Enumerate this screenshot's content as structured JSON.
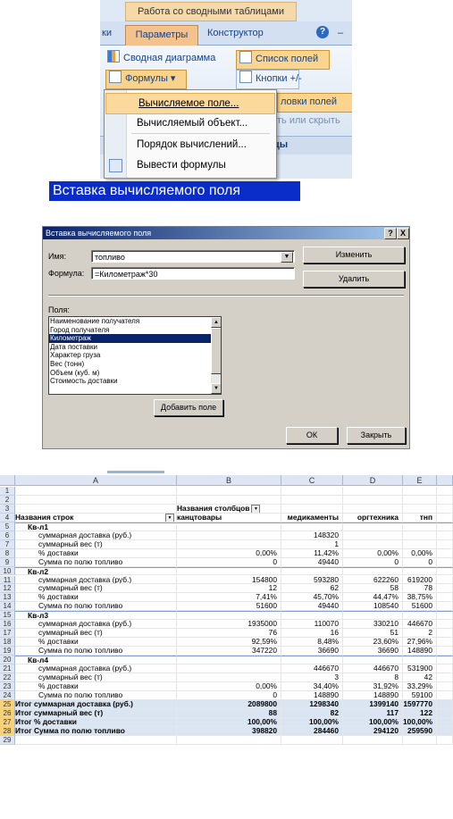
{
  "ribbon": {
    "context_title": "Работа со сводными таблицами",
    "tab_partial": "ки",
    "tab_parameters": "Параметры",
    "tab_constructor": "Конструктор",
    "tab_help": "?",
    "tab_dash": "–",
    "btn_pivot_chart": "Сводная диаграмма",
    "btn_formulas": "Формулы ▾",
    "btn_field_list": "Список полей",
    "btn_plus_minus": "Кнопки +/-",
    "btn_headers": "ловки полей",
    "btn_show_hide": "ть или скрыть",
    "group_label": "цы"
  },
  "menu": {
    "items": [
      "Вычисляемое поле...",
      "Вычисляемый объект...",
      "Порядок вычислений...",
      "Вывести формулы"
    ]
  },
  "caption": "Вставка вычисляемого поля",
  "dialog": {
    "title": "Вставка вычисляемого поля",
    "help": "?",
    "close": "X",
    "name_label": "Имя:",
    "name_value": "топливо",
    "formula_label": "Формула:",
    "formula_value": "=Километраж*30",
    "btn_edit": "Изменить",
    "btn_delete": "Удалить",
    "fields_label": "Поля:",
    "fields": [
      "Наименование получателя",
      "Город получателя",
      "Километраж",
      "Дата поставки",
      "Характер груза",
      "Вес (тонн)",
      "Объем (куб. м)",
      "Стоимость доставки"
    ],
    "selected_field": "Километраж",
    "btn_add": "Добавить поле",
    "btn_ok": "ОК",
    "btn_close": "Закрыть"
  },
  "sheet": {
    "columns": [
      "A",
      "B",
      "C",
      "D",
      "E"
    ],
    "rows": [
      {
        "n": "1",
        "a": "",
        "b": "",
        "c": "",
        "d": "",
        "e": ""
      },
      {
        "n": "2",
        "a": "",
        "b": "",
        "c": "",
        "d": "",
        "e": ""
      },
      {
        "n": "3",
        "a": "",
        "b": "Названия столбцов",
        "c": "",
        "d": "",
        "e": ""
      },
      {
        "n": "4",
        "a": "Названия строк",
        "b": "канцтовары",
        "c": "медикаменты",
        "d": "оргтехника",
        "e": "тнп"
      },
      {
        "n": "5",
        "a": "Кв-л1",
        "b": "",
        "c": "",
        "d": "",
        "e": ""
      },
      {
        "n": "6",
        "a": "суммарная доставка (руб.)",
        "b": "",
        "c": "148320",
        "d": "",
        "e": ""
      },
      {
        "n": "7",
        "a": "суммарный вес (т)",
        "b": "",
        "c": "1",
        "d": "",
        "e": ""
      },
      {
        "n": "8",
        "a": "% доставки",
        "b": "0,00%",
        "c": "11,42%",
        "d": "0,00%",
        "e": "0,00%"
      },
      {
        "n": "9",
        "a": "Сумма по полю топливо",
        "b": "0",
        "c": "49440",
        "d": "0",
        "e": "0"
      },
      {
        "n": "10",
        "a": "Кв-л2",
        "b": "",
        "c": "",
        "d": "",
        "e": ""
      },
      {
        "n": "11",
        "a": "суммарная доставка (руб.)",
        "b": "154800",
        "c": "593280",
        "d": "622260",
        "e": "619200"
      },
      {
        "n": "12",
        "a": "суммарный вес (т)",
        "b": "12",
        "c": "62",
        "d": "58",
        "e": "78"
      },
      {
        "n": "13",
        "a": "% доставки",
        "b": "7,41%",
        "c": "45,70%",
        "d": "44,47%",
        "e": "38,75%"
      },
      {
        "n": "14",
        "a": "Сумма по полю топливо",
        "b": "51600",
        "c": "49440",
        "d": "108540",
        "e": "51600"
      },
      {
        "n": "15",
        "a": "Кв-л3",
        "b": "",
        "c": "",
        "d": "",
        "e": ""
      },
      {
        "n": "16",
        "a": "суммарная доставка (руб.)",
        "b": "1935000",
        "c": "110070",
        "d": "330210",
        "e": "446670"
      },
      {
        "n": "17",
        "a": "суммарный вес (т)",
        "b": "76",
        "c": "16",
        "d": "51",
        "e": "2"
      },
      {
        "n": "18",
        "a": "% доставки",
        "b": "92,59%",
        "c": "8,48%",
        "d": "23,60%",
        "e": "27,96%"
      },
      {
        "n": "19",
        "a": "Сумма по полю топливо",
        "b": "347220",
        "c": "36690",
        "d": "36690",
        "e": "148890"
      },
      {
        "n": "20",
        "a": "Кв-л4",
        "b": "",
        "c": "",
        "d": "",
        "e": ""
      },
      {
        "n": "21",
        "a": "суммарная доставка (руб.)",
        "b": "",
        "c": "446670",
        "d": "446670",
        "e": "531900"
      },
      {
        "n": "22",
        "a": "суммарный вес (т)",
        "b": "",
        "c": "3",
        "d": "8",
        "e": "42"
      },
      {
        "n": "23",
        "a": "% доставки",
        "b": "0,00%",
        "c": "34,40%",
        "d": "31,92%",
        "e": "33,29%"
      },
      {
        "n": "24",
        "a": "Сумма по полю топливо",
        "b": "0",
        "c": "148890",
        "d": "148890",
        "e": "59100"
      },
      {
        "n": "25",
        "a": "Итог суммарная доставка (руб.)",
        "b": "2089800",
        "c": "1298340",
        "d": "1399140",
        "e": "1597770"
      },
      {
        "n": "26",
        "a": "Итог суммарный вес (т)",
        "b": "88",
        "c": "82",
        "d": "117",
        "e": "122"
      },
      {
        "n": "27",
        "a": "Итог % доставки",
        "b": "100,00%",
        "c": "100,00%",
        "d": "100,00%",
        "e": "100,00%"
      },
      {
        "n": "28",
        "a": "Итог Сумма по полю топливо",
        "b": "398820",
        "c": "284460",
        "d": "294120",
        "e": "259590"
      },
      {
        "n": "29",
        "a": "",
        "b": "",
        "c": "",
        "d": "",
        "e": ""
      }
    ]
  }
}
